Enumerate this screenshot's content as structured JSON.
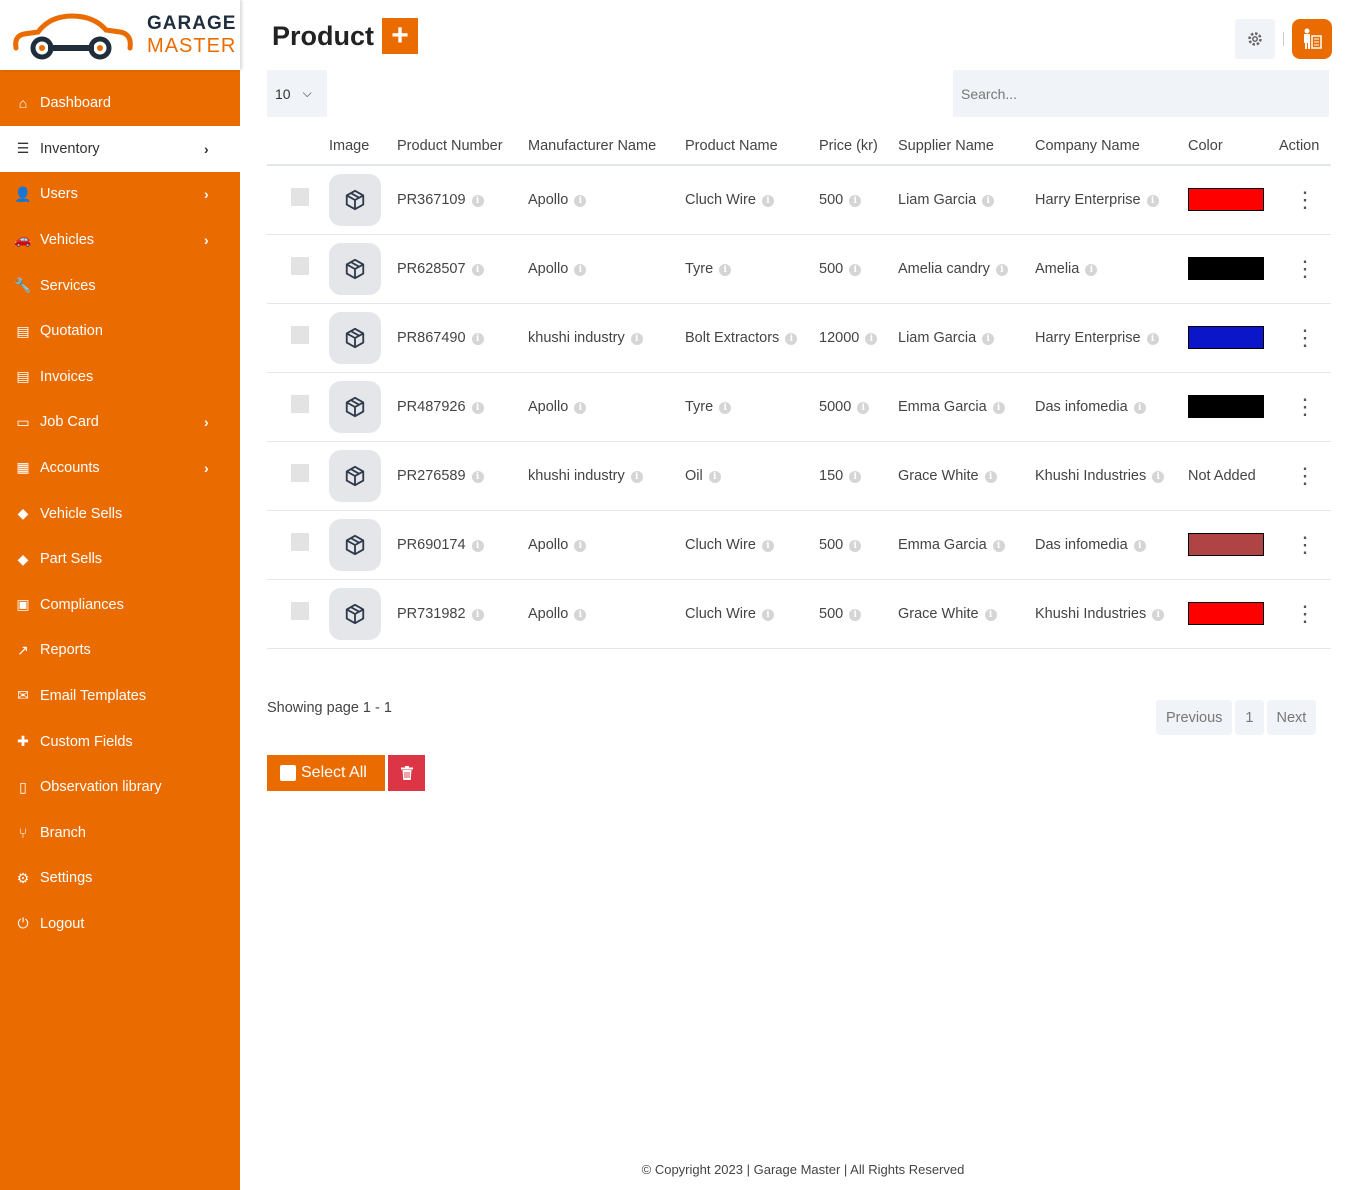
{
  "brand": {
    "line1": "GARAGE",
    "line2": "MASTER",
    "accent": "#ea6c00"
  },
  "sidebar": {
    "items": [
      {
        "label": "Dashboard",
        "icon": "home-icon",
        "glyph": "⌂",
        "chevron": false,
        "active": false
      },
      {
        "label": "Inventory",
        "icon": "sliders-icon",
        "glyph": "☰",
        "chevron": true,
        "active": true
      },
      {
        "label": "Users",
        "icon": "user-icon",
        "glyph": "👤",
        "chevron": true,
        "active": false
      },
      {
        "label": "Vehicles",
        "icon": "car-icon",
        "glyph": "🚗",
        "chevron": true,
        "active": false
      },
      {
        "label": "Services",
        "icon": "wrench-icon",
        "glyph": "🔧",
        "chevron": false,
        "active": false
      },
      {
        "label": "Quotation",
        "icon": "invoice-dollar-icon",
        "glyph": "▤",
        "chevron": false,
        "active": false
      },
      {
        "label": "Invoices",
        "icon": "receipt-icon",
        "glyph": "▤",
        "chevron": false,
        "active": false
      },
      {
        "label": "Job Card",
        "icon": "credit-card-icon",
        "glyph": "▭",
        "chevron": true,
        "active": false
      },
      {
        "label": "Accounts",
        "icon": "calculator-icon",
        "glyph": "▦",
        "chevron": true,
        "active": false
      },
      {
        "label": "Vehicle Sells",
        "icon": "tag-icon",
        "glyph": "◆",
        "chevron": false,
        "active": false
      },
      {
        "label": "Part Sells",
        "icon": "tag-icon",
        "glyph": "◆",
        "chevron": false,
        "active": false
      },
      {
        "label": "Compliances",
        "icon": "clipboard-check-icon",
        "glyph": "▣",
        "chevron": false,
        "active": false
      },
      {
        "label": "Reports",
        "icon": "chart-line-icon",
        "glyph": "↗",
        "chevron": false,
        "active": false
      },
      {
        "label": "Email Templates",
        "icon": "envelope-open-icon",
        "glyph": "✉",
        "chevron": false,
        "active": false
      },
      {
        "label": "Custom Fields",
        "icon": "puzzle-icon",
        "glyph": "✚",
        "chevron": false,
        "active": false
      },
      {
        "label": "Observation library",
        "icon": "file-icon",
        "glyph": "▯",
        "chevron": false,
        "active": false
      },
      {
        "label": "Branch",
        "icon": "code-branch-icon",
        "glyph": "⑂",
        "chevron": false,
        "active": false
      },
      {
        "label": "Settings",
        "icon": "gear-icon",
        "glyph": "⚙",
        "chevron": false,
        "active": false
      },
      {
        "label": "Logout",
        "icon": "power-icon",
        "glyph": "⏻",
        "chevron": false,
        "active": false
      }
    ]
  },
  "header": {
    "title": "Product",
    "add_label": "+"
  },
  "controls": {
    "page_length": "10",
    "search_placeholder": "Search..."
  },
  "table": {
    "columns": [
      "",
      "Image",
      "Product Number",
      "Manufacturer Name",
      "Product Name",
      "Price (kr)",
      "Supplier Name",
      "Company Name",
      "Color",
      "Action"
    ],
    "rows": [
      {
        "number": "PR367109",
        "manufacturer": "Apollo",
        "product": "Cluch Wire",
        "price": "500",
        "supplier": "Liam Garcia",
        "company": "Harry Enterprise",
        "color": "#ff0000",
        "color_text": ""
      },
      {
        "number": "PR628507",
        "manufacturer": "Apollo",
        "product": "Tyre",
        "price": "500",
        "supplier": "Amelia candry",
        "company": "Amelia",
        "color": "#000000",
        "color_text": ""
      },
      {
        "number": "PR867490",
        "manufacturer": "khushi industry",
        "product": "Bolt Extractors",
        "price": "12000",
        "supplier": "Liam Garcia",
        "company": "Harry Enterprise",
        "color": "#0b16c8",
        "color_text": ""
      },
      {
        "number": "PR487926",
        "manufacturer": "Apollo",
        "product": "Tyre",
        "price": "5000",
        "supplier": "Emma Garcia",
        "company": "Das infomedia",
        "color": "#000000",
        "color_text": ""
      },
      {
        "number": "PR276589",
        "manufacturer": "khushi industry",
        "product": "Oil",
        "price": "150",
        "supplier": "Grace White",
        "company": "Khushi Industries",
        "color": "",
        "color_text": "Not Added"
      },
      {
        "number": "PR690174",
        "manufacturer": "Apollo",
        "product": "Cluch Wire",
        "price": "500",
        "supplier": "Emma Garcia",
        "company": "Das infomedia",
        "color": "#b04444",
        "color_text": ""
      },
      {
        "number": "PR731982",
        "manufacturer": "Apollo",
        "product": "Cluch Wire",
        "price": "500",
        "supplier": "Grace White",
        "company": "Khushi Industries",
        "color": "#ff0000",
        "color_text": ""
      }
    ]
  },
  "pagination": {
    "showing": "Showing page 1 - 1",
    "previous": "Previous",
    "current": "1",
    "next": "Next"
  },
  "bulk": {
    "select_all": "Select All"
  },
  "footer": {
    "copyright": "© Copyright 2023 | Garage Master | All Rights Reserved"
  }
}
